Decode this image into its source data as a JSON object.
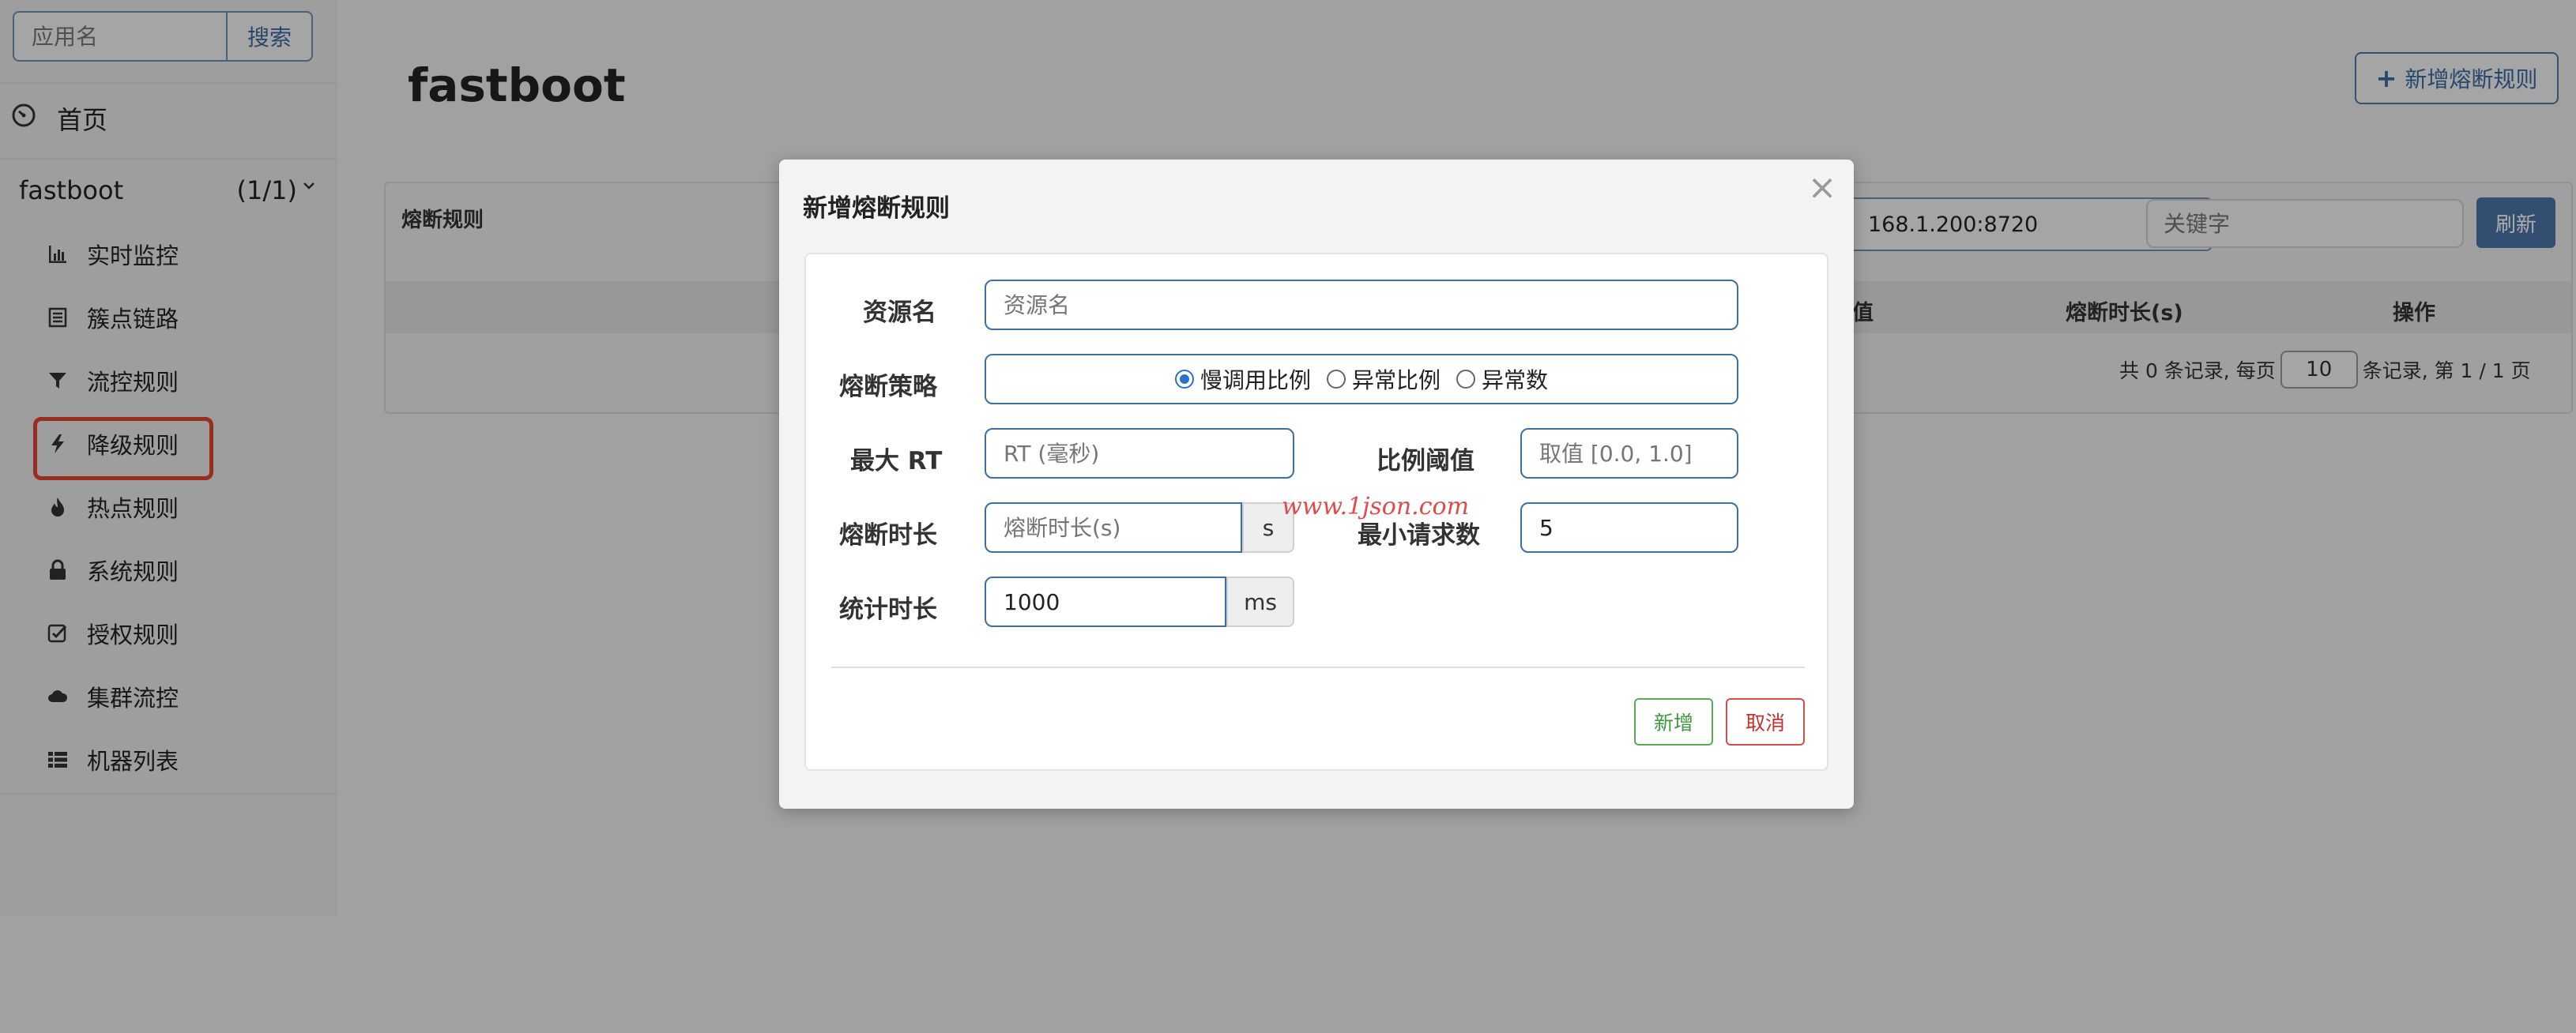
{
  "sidebar": {
    "search_placeholder": "应用名",
    "search_button": "搜索",
    "home_label": "首页",
    "app_name": "fastboot",
    "app_count": "(1/1)",
    "items": [
      {
        "label": "实时监控",
        "icon": "bar-chart-icon"
      },
      {
        "label": "簇点链路",
        "icon": "list-icon"
      },
      {
        "label": "流控规则",
        "icon": "filter-icon"
      },
      {
        "label": "降级规则",
        "icon": "bolt-icon"
      },
      {
        "label": "热点规则",
        "icon": "fire-icon"
      },
      {
        "label": "系统规则",
        "icon": "lock-icon"
      },
      {
        "label": "授权规则",
        "icon": "check-icon"
      },
      {
        "label": "集群流控",
        "icon": "cloud-icon"
      },
      {
        "label": "机器列表",
        "icon": "th-list-icon"
      }
    ],
    "highlight_color": "#e0452e"
  },
  "main": {
    "page_title": "fastboot",
    "add_rule_button": "新增熔断规则",
    "panel": {
      "title": "熔断规则",
      "machine_select": "168.1.200:8720",
      "keyword_placeholder": "关键字",
      "refresh_button": "刷新",
      "columns": {
        "c1": "值",
        "c2": "熔断时长(s)",
        "c3": "操作"
      },
      "pager_prefix": "共 0 条记录, 每页",
      "page_size": "10",
      "pager_suffix": "条记录, 第 1 / 1 页"
    }
  },
  "modal": {
    "title": "新增熔断规则",
    "close_symbol": "×",
    "resource_label": "资源名",
    "resource_placeholder": "资源名",
    "strategy_label": "熔断策略",
    "strategy_options": [
      "慢调用比例",
      "异常比例",
      "异常数"
    ],
    "strategy_selected": "慢调用比例",
    "max_rt_label": "最大 RT",
    "max_rt_placeholder": "RT (毫秒)",
    "ratio_label": "比例阈值",
    "ratio_placeholder": "取值 [0.0, 1.0]",
    "duration_label": "熔断时长",
    "duration_placeholder": "熔断时长(s)",
    "duration_unit": "s",
    "min_request_label": "最小请求数",
    "min_request_value": "5",
    "stat_label": "统计时长",
    "stat_value": "1000",
    "stat_unit": "ms",
    "watermark": "www.1json.com",
    "add_button": "新增",
    "cancel_button": "取消"
  },
  "colors": {
    "accent": "#3a6aa0",
    "primary_button": "#4a73a5",
    "success": "#3e9a3e",
    "danger": "#c9302c"
  }
}
